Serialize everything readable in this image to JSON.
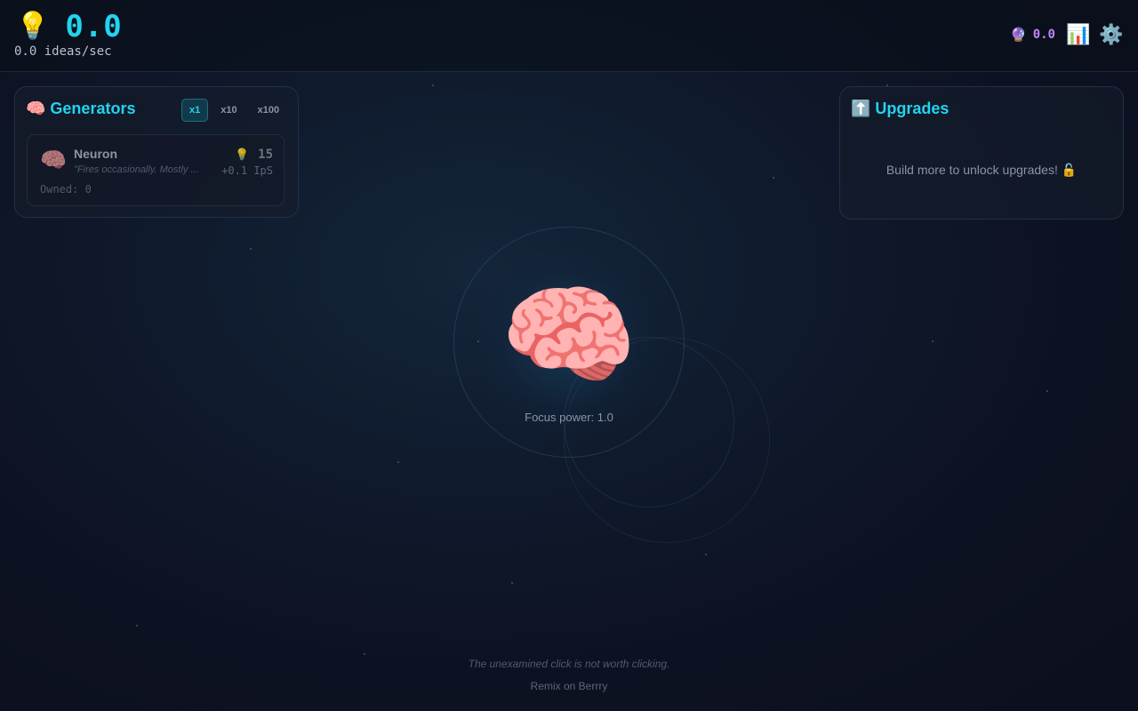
{
  "header": {
    "score_icon": "lightbulb-icon",
    "score_value": "0.0",
    "rate_text": "0.0 ideas/sec",
    "essence_icon": "crystal-ball-icon",
    "essence_value": "0.0",
    "stats_icon": "bar-chart-icon",
    "settings_icon": "gear-icon"
  },
  "generators": {
    "title": "Generators",
    "title_icon": "brain-icon",
    "multipliers": [
      "x1",
      "x10",
      "x100"
    ],
    "active_multiplier": "x1",
    "items": [
      {
        "icon": "brain-icon",
        "name": "Neuron",
        "cost": "15",
        "description": "\"Fires occasionally. Mostly ...",
        "ips": "+0.1 IpS",
        "owned": "Owned: 0"
      }
    ]
  },
  "upgrades": {
    "title": "Upgrades",
    "title_icon": "up-arrow-icon",
    "empty_message": "Build more to unlock upgrades! 🔓"
  },
  "clicker": {
    "icon": "brain-icon",
    "focus_text": "Focus power: 1.0"
  },
  "footer": {
    "quote": "The unexamined click is not worth clicking.",
    "remix_link": "Remix on Berrry"
  },
  "colors": {
    "accent": "#22d3ee",
    "essence": "#c084fc",
    "background": "#0d1222"
  }
}
